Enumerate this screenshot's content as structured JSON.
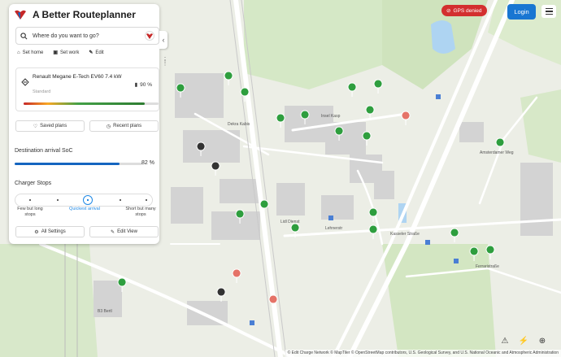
{
  "app": {
    "title": "A Better Routeplanner"
  },
  "search": {
    "placeholder": "Where do you want to go?"
  },
  "quick_actions": {
    "home": "Set home",
    "work": "Set work",
    "edit": "Edit"
  },
  "vehicle": {
    "name": "Renault Megane E-Tech EV60 7.4 kW",
    "variant": "Standard",
    "soc": "90 %",
    "soc_level": 0.9
  },
  "plans": {
    "saved": "Saved plans",
    "recent": "Recent plans"
  },
  "arrival": {
    "label": "Destination arrival SoC",
    "value": "82 %",
    "level": 0.82
  },
  "charger_stops": {
    "label": "Charger Stops",
    "left": "Few but long stops",
    "middle": "Quickest arrival",
    "right": "Short but many stops"
  },
  "footer_buttons": {
    "settings": "All Settings",
    "edit_view": "Edit View"
  },
  "topbar": {
    "gps": "GPS denied",
    "login": "Login"
  },
  "map": {
    "attribution": "© Edit Charge Network  © MapTiler  © OpenStreetMap contributors, U.S. Geological Survey, and U.S. National Oceanic and Atmospheric Administration",
    "labels": [
      "Insel Kasp",
      "Dekra Kabis",
      "Lidl Dienst",
      "Kasseler Straße",
      "B3 Bertl",
      "Lehnerstr",
      "Amsterdamer Weg",
      "Ferraristraße"
    ],
    "tools": [
      "warning-icon",
      "charger-icon",
      "locate-icon"
    ]
  }
}
